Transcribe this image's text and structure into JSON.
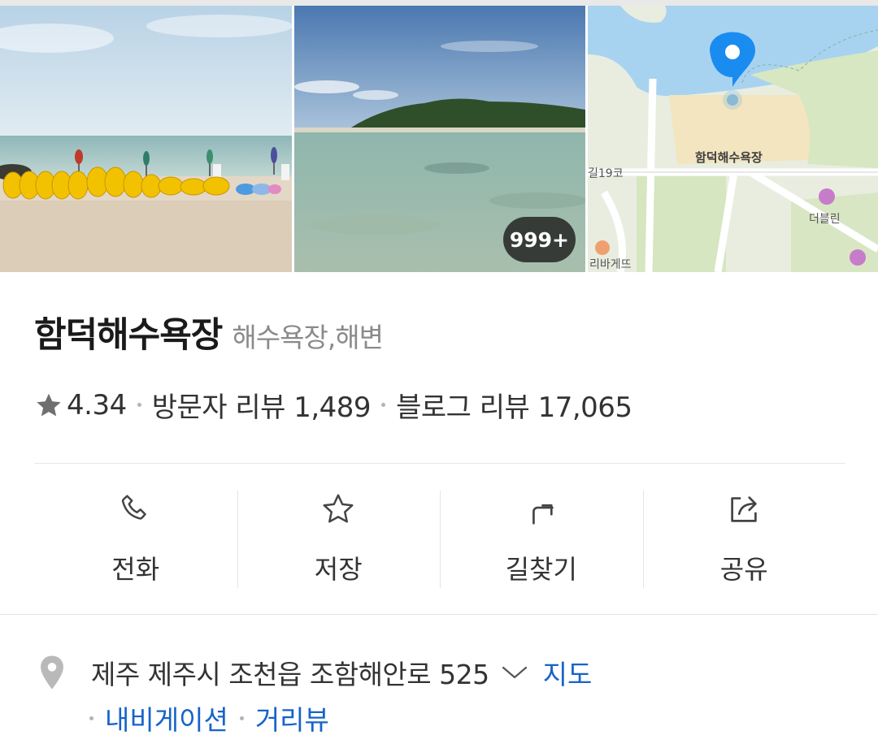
{
  "photos": {
    "count_badge": "999+",
    "map": {
      "poi_label": "함덕해수욕장",
      "road_label": "길19코",
      "place_label": "더블린",
      "shop_label": "리바게뜨"
    }
  },
  "place": {
    "name": "함덕해수욕장",
    "category": "해수욕장,해변"
  },
  "rating": {
    "score": "4.34",
    "visitor_reviews": "방문자 리뷰 1,489",
    "blog_reviews": "블로그 리뷰 17,065"
  },
  "actions": [
    {
      "label": "전화",
      "icon": "phone-icon"
    },
    {
      "label": "저장",
      "icon": "star-icon"
    },
    {
      "label": "길찾기",
      "icon": "directions-icon"
    },
    {
      "label": "공유",
      "icon": "share-icon"
    }
  ],
  "address": {
    "text": "제주 제주시 조천읍 조함해안로 525",
    "map_link": "지도",
    "navigation_link": "내비게이션",
    "streetview_link": "거리뷰"
  },
  "colors": {
    "link": "#1763c9",
    "map_pin": "#1a8cf0"
  }
}
